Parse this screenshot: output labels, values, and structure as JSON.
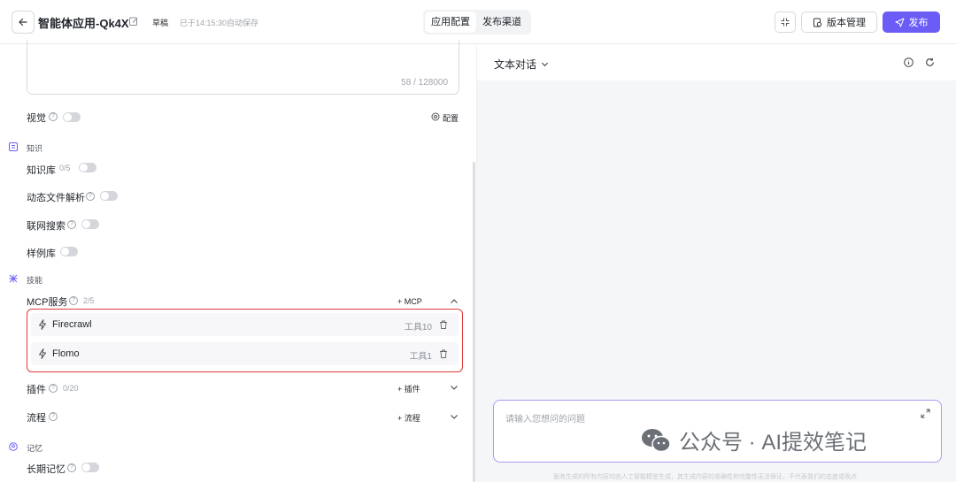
{
  "header": {
    "app_title": "智能体应用-Qk4X",
    "draft_badge": "草稿",
    "saved_status": "已于14:15:30自动保存",
    "tabs": [
      {
        "label": "应用配置",
        "active": true
      },
      {
        "label": "发布渠道",
        "active": false
      }
    ],
    "version_label": "版本管理",
    "publish_label": "发布"
  },
  "config": {
    "prompt_char_count": "58 / 128000",
    "vision": {
      "label": "视觉",
      "enabled": false,
      "config_label": "配置"
    },
    "knowledge_section": "知识",
    "knowledge_base": {
      "label": "知识库",
      "count": "0/5",
      "enabled": false
    },
    "dynamic_file": {
      "label": "动态文件解析",
      "enabled": false
    },
    "web_search": {
      "label": "联网搜索",
      "enabled": false
    },
    "example_lib": {
      "label": "样例库",
      "enabled": false
    },
    "skills_section": "技能",
    "mcp": {
      "label": "MCP服务",
      "count": "2/5",
      "add_label": "MCP",
      "items": [
        {
          "name": "Firecrawl",
          "tools": "工具10"
        },
        {
          "name": "Flomo",
          "tools": "工具1"
        }
      ]
    },
    "plugins": {
      "label": "插件",
      "count": "0/20",
      "add_label": "插件"
    },
    "flows": {
      "label": "流程",
      "add_label": "流程"
    },
    "memory_section": "记忆",
    "long_memory": {
      "label": "长期记忆",
      "enabled": false
    }
  },
  "chat": {
    "mode_label": "文本对话",
    "input_placeholder": "请输入您想问的问题",
    "disclaimer": "服务生成的所有内容均由人工智能模型生成，其生成内容的准确性和完整性无法保证，不代表我们的态度或观点"
  },
  "watermark": {
    "text": "公众号 · AI提效笔记"
  },
  "colors": {
    "accent": "#6a5cf5",
    "highlight_border": "#e03a3a",
    "input_border": "#a99cf5"
  }
}
